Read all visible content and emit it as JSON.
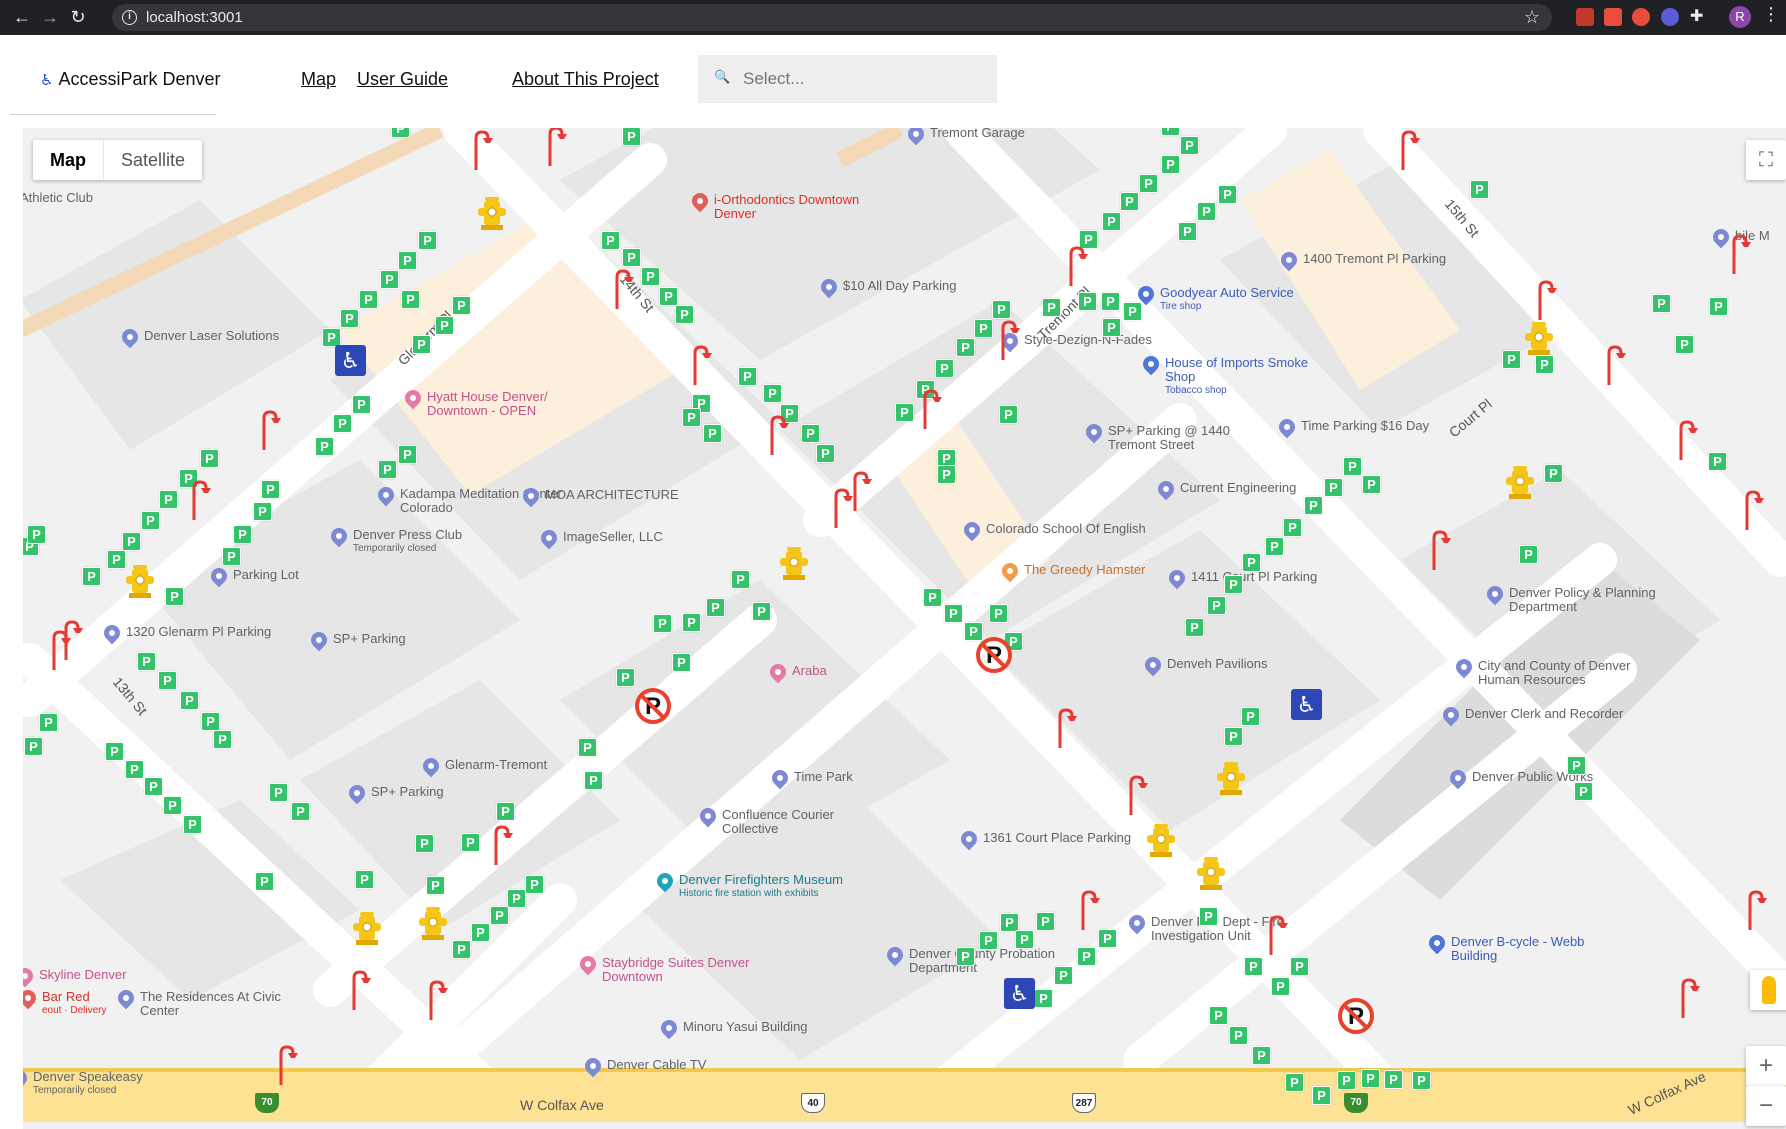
{
  "browser": {
    "url": "localhost:3001",
    "profile_initial": "R",
    "extension_colors": [
      "#c0392b",
      "#e74c3c",
      "#e74c3c",
      "#5b5bd6",
      "#e8eaed"
    ]
  },
  "app": {
    "brand": "AccessiPark Denver",
    "brand_icon": "wheelchair-icon",
    "nav": [
      "Map",
      "User Guide",
      "About This Project"
    ],
    "search_placeholder": "Select..."
  },
  "map": {
    "map_type": {
      "map": "Map",
      "satellite": "Satellite",
      "selected": "Map"
    },
    "colors": {
      "parking": "#34c36a",
      "hydrant": "#f5c518",
      "lamp": "#e53935",
      "accessible": "#2d48b6",
      "no_parking": "#e8412c",
      "colfax": "#fde293"
    },
    "places": [
      {
        "name": "Tremont Garage",
        "sub": "",
        "style": ""
      },
      {
        "name": "i-Orthodontics Downtown Denver",
        "sub": "",
        "style": "red"
      },
      {
        "name": "Athletic Club",
        "sub": "",
        "style": ""
      },
      {
        "name": "$10 All Day Parking",
        "sub": "",
        "style": ""
      },
      {
        "name": "1400 Tremont Pl Parking",
        "sub": "",
        "style": ""
      },
      {
        "name": "Goodyear Auto Service",
        "sub": "Tire shop",
        "style": "blue"
      },
      {
        "name": "Denver Laser Solutions",
        "sub": "",
        "style": ""
      },
      {
        "name": "Style-Dezign-N-Fades",
        "sub": "",
        "style": ""
      },
      {
        "name": "House of Imports Smoke Shop",
        "sub": "Tobacco shop",
        "style": "blue"
      },
      {
        "name": "Hyatt House Denver/ Downtown - OPEN",
        "sub": "",
        "style": "pink"
      },
      {
        "name": "SP+ Parking @ 1440 Tremont Street",
        "sub": "",
        "style": ""
      },
      {
        "name": "Time Parking $16 Day",
        "sub": "",
        "style": ""
      },
      {
        "name": "Kadampa Meditation Center Colorado",
        "sub": "",
        "style": ""
      },
      {
        "name": "MOA ARCHITECTURE",
        "sub": "",
        "style": ""
      },
      {
        "name": "Current Engineering",
        "sub": "",
        "style": ""
      },
      {
        "name": "Denver Press Club",
        "sub": "Temporarily closed",
        "style": ""
      },
      {
        "name": "ImageSeller, LLC",
        "sub": "",
        "style": ""
      },
      {
        "name": "Colorado School Of English",
        "sub": "",
        "style": ""
      },
      {
        "name": "Parking Lot",
        "sub": "",
        "style": ""
      },
      {
        "name": "The Greedy Hamster",
        "sub": "",
        "style": "orange"
      },
      {
        "name": "1411 Court Pl Parking",
        "sub": "",
        "style": ""
      },
      {
        "name": "Denver Policy & Planning Department",
        "sub": "",
        "style": ""
      },
      {
        "name": "1320 Glenarm Pl Parking",
        "sub": "",
        "style": ""
      },
      {
        "name": "SP+ Parking",
        "sub": "",
        "style": ""
      },
      {
        "name": "Araba",
        "sub": "",
        "style": "pink"
      },
      {
        "name": "Denveh Pavilions",
        "sub": "",
        "style": ""
      },
      {
        "name": "City and County of Denver Human Resources",
        "sub": "",
        "style": ""
      },
      {
        "name": "Denver Clerk and Recorder",
        "sub": "",
        "style": ""
      },
      {
        "name": "Glenarm-Tremont",
        "sub": "",
        "style": ""
      },
      {
        "name": "SP+ Parking",
        "sub": "",
        "style": ""
      },
      {
        "name": "Time Park",
        "sub": "",
        "style": ""
      },
      {
        "name": "Denver Public Works",
        "sub": "",
        "style": ""
      },
      {
        "name": "Confluence Courier Collective",
        "sub": "",
        "style": ""
      },
      {
        "name": "1361 Court Place Parking",
        "sub": "",
        "style": ""
      },
      {
        "name": "Denver Firefighters Museum",
        "sub": "Historic fire station with exhibits",
        "style": "teal"
      },
      {
        "name": "Denver Fire Dept - Fire Investigation Unit",
        "sub": "",
        "style": ""
      },
      {
        "name": "Skyline Denver",
        "sub": "",
        "style": "pink"
      },
      {
        "name": "Staybridge Suites Denver Downtown",
        "sub": "",
        "style": "pink"
      },
      {
        "name": "Denver County Probation Department",
        "sub": "",
        "style": ""
      },
      {
        "name": "Denver B-cycle - Webb Building",
        "sub": "",
        "style": "blue"
      },
      {
        "name": "Bar Red",
        "sub": "eout · Delivery",
        "style": "red"
      },
      {
        "name": "The Residences At Civic Center",
        "sub": "",
        "style": ""
      },
      {
        "name": "Minoru Yasui Building",
        "sub": "",
        "style": ""
      },
      {
        "name": "Denver Speakeasy",
        "sub": "Temporarily closed",
        "style": ""
      },
      {
        "name": "Denver Cable TV",
        "sub": "",
        "style": ""
      },
      {
        "name": "bile M",
        "sub": "",
        "style": ""
      }
    ],
    "streets": [
      "Glenarm Pl",
      "14th St",
      "Tremont Pl",
      "Court Pl",
      "15th St",
      "13th St",
      "W Colfax Ave",
      "W Colfax Ave"
    ],
    "shields": [
      {
        "text": "70",
        "type": "interstate"
      },
      {
        "text": "40",
        "type": "us"
      },
      {
        "text": "287",
        "type": "us"
      },
      {
        "text": "70",
        "type": "interstate"
      }
    ],
    "marker_symbols": {
      "parking": "P",
      "accessible": "♿",
      "no_parking": "P"
    },
    "zoom": {
      "in": "+",
      "out": "−"
    }
  }
}
